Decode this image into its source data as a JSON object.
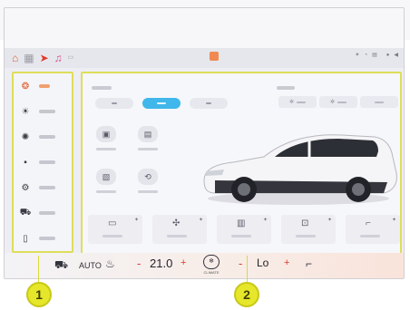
{
  "status_bar": {
    "icons": [
      "home-icon",
      "apps-grid-icon",
      "navigation-icon",
      "music-icon",
      "map-icon"
    ],
    "right_icons": [
      "bluetooth-icon",
      "signal-icon",
      "network-icon",
      "user-icon",
      "volume-icon"
    ],
    "time_text": ""
  },
  "left_menu": {
    "items": [
      {
        "icon": "fan-icon",
        "glyph": "❂",
        "active": true
      },
      {
        "icon": "sun-icon",
        "glyph": "☀",
        "active": false
      },
      {
        "icon": "light-icon",
        "glyph": "✺",
        "active": false
      },
      {
        "icon": "seat-grid-icon",
        "glyph": "▪",
        "active": false
      },
      {
        "icon": "car-settings-icon",
        "glyph": "⚙",
        "active": false
      },
      {
        "icon": "car-icon",
        "glyph": "⛟",
        "active": false
      },
      {
        "icon": "phone-icon",
        "glyph": "▯",
        "active": false
      }
    ]
  },
  "climate_bar": {
    "auto_label": "AUTO",
    "minus": "-",
    "temperature": "21.0",
    "plus": "+",
    "climate_label": "CLIMATE",
    "fan_minus": "-",
    "fan_level": "Lo",
    "fan_plus": "+"
  },
  "callouts": {
    "one": "1",
    "two": "2"
  },
  "colors": {
    "accent_blue": "#3fb7ea",
    "accent_orange": "#e05a2b",
    "callout_yellow": "#e6e62a",
    "temp_red": "#e03b2b"
  }
}
